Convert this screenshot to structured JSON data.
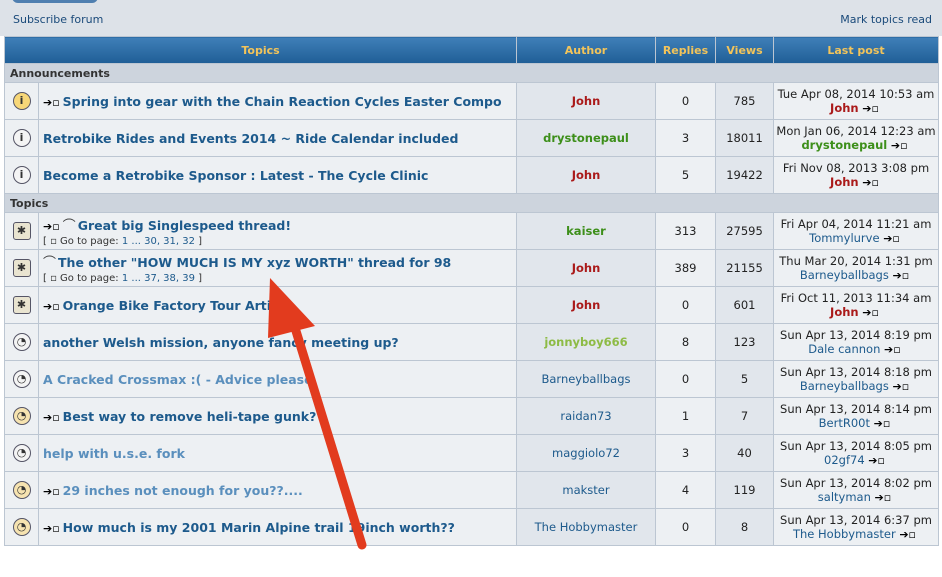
{
  "toolbar": {
    "subscribe": "Subscribe forum",
    "mark_read": "Mark topics read"
  },
  "headers": {
    "topics": "Topics",
    "author": "Author",
    "replies": "Replies",
    "views": "Views",
    "last_post": "Last post"
  },
  "sections": {
    "announcements": "Announcements",
    "topics": "Topics"
  },
  "announcements": [
    {
      "title": "Spring into gear with the Chain Reaction Cycles Easter Compo",
      "author": "John",
      "replies": "0",
      "views": "785",
      "last_date": "Tue Apr 08, 2014 10:53 am",
      "last_by": "John"
    },
    {
      "title": "Retrobike Rides and Events 2014 ~ Ride Calendar included",
      "author": "drystonepaul",
      "replies": "3",
      "views": "18011",
      "last_date": "Mon Jan 06, 2014 12:23 am",
      "last_by": "drystonepaul"
    },
    {
      "title": "Become a Retrobike Sponsor : Latest - The Cycle Clinic",
      "author": "John",
      "replies": "5",
      "views": "19422",
      "last_date": "Fri Nov 08, 2013 3:08 pm",
      "last_by": "John"
    }
  ],
  "topics": [
    {
      "title": "Great big Singlespeed thread!",
      "pages_prefix": "Go to page:",
      "pages": "1 ... 30, 31, 32",
      "author": "kaiser",
      "replies": "313",
      "views": "27595",
      "last_date": "Fri Apr 04, 2014 11:21 am",
      "last_by": "Tommylurve"
    },
    {
      "title": "The other \"HOW MUCH IS MY xyz WORTH\" thread for 98",
      "pages_prefix": "Go to page:",
      "pages": "1 ... 37, 38, 39",
      "author": "John",
      "replies": "389",
      "views": "21155",
      "last_date": "Thu Mar 20, 2014 1:31 pm",
      "last_by": "Barneyballbags"
    },
    {
      "title": "Orange Bike Factory Tour Article",
      "author": "John",
      "replies": "0",
      "views": "601",
      "last_date": "Fri Oct 11, 2013 11:34 am",
      "last_by": "John"
    },
    {
      "title": "another Welsh mission, anyone fancy meeting up?",
      "author": "jonnyboy666",
      "replies": "8",
      "views": "123",
      "last_date": "Sun Apr 13, 2014 8:19 pm",
      "last_by": "Dale cannon"
    },
    {
      "title": "A Cracked Crossmax :( - Advice please",
      "author": "Barneyballbags",
      "replies": "0",
      "views": "5",
      "last_date": "Sun Apr 13, 2014 8:18 pm",
      "last_by": "Barneyballbags"
    },
    {
      "title": "Best way to remove heli-tape gunk?",
      "author": "raidan73",
      "replies": "1",
      "views": "7",
      "last_date": "Sun Apr 13, 2014 8:14 pm",
      "last_by": "BertR00t"
    },
    {
      "title": "help with u.s.e. fork",
      "author": "maggiolo72",
      "replies": "3",
      "views": "40",
      "last_date": "Sun Apr 13, 2014 8:05 pm",
      "last_by": "02gf74"
    },
    {
      "title": "29 inches not enough for you??....",
      "author": "makster",
      "replies": "4",
      "views": "119",
      "last_date": "Sun Apr 13, 2014 8:02 pm",
      "last_by": "saltyman"
    },
    {
      "title": "How much is my 2001 Marin Alpine trail 19inch worth??",
      "author": "The Hobbymaster",
      "replies": "0",
      "views": "8",
      "last_date": "Sun Apr 13, 2014 6:37 pm",
      "last_by": "The Hobbymaster"
    }
  ],
  "icons": {
    "announcement": "info-icon",
    "hot": "hot-topic-icon",
    "normal": "topic-icon",
    "attachment": "paperclip-icon",
    "newest": "go-to-newest-post-icon"
  },
  "colors": {
    "header_bg": "#2e6ea8",
    "header_text": "#f3c45a",
    "link": "#1d5a8c",
    "author_red": "#aa1a1a",
    "author_green": "#3d8f1a",
    "annotation_arrow": "#e23b1e"
  }
}
